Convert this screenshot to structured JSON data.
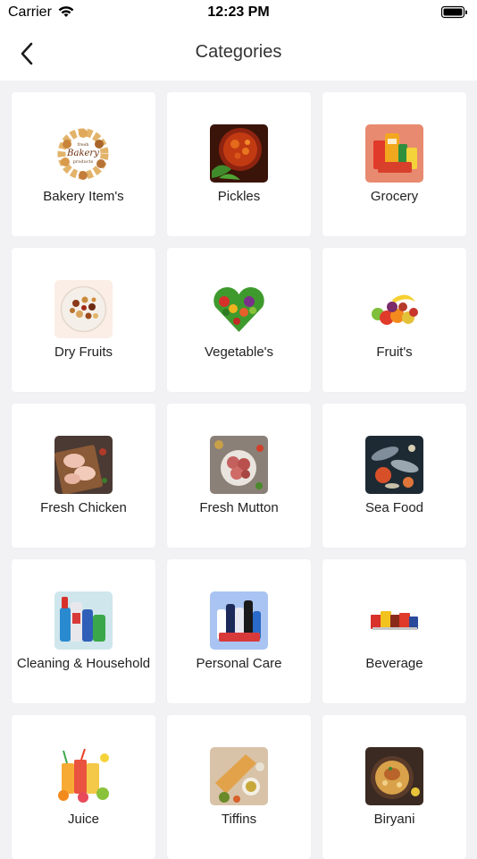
{
  "status": {
    "carrier": "Carrier",
    "time": "12:23 PM"
  },
  "nav": {
    "title": "Categories"
  },
  "categories": [
    {
      "label": "Bakery Item's",
      "icon": "bakery-icon"
    },
    {
      "label": "Pickles",
      "icon": "pickles-icon"
    },
    {
      "label": "Grocery",
      "icon": "grocery-icon"
    },
    {
      "label": "Dry Fruits",
      "icon": "dry-fruits-icon"
    },
    {
      "label": "Vegetable's",
      "icon": "vegetables-icon"
    },
    {
      "label": "Fruit's",
      "icon": "fruits-icon"
    },
    {
      "label": "Fresh Chicken",
      "icon": "chicken-icon"
    },
    {
      "label": "Fresh Mutton",
      "icon": "mutton-icon"
    },
    {
      "label": "Sea Food",
      "icon": "seafood-icon"
    },
    {
      "label": "Cleaning & Household",
      "icon": "cleaning-icon"
    },
    {
      "label": "Personal Care",
      "icon": "personal-care-icon"
    },
    {
      "label": "Beverage",
      "icon": "beverage-icon"
    },
    {
      "label": "Juice",
      "icon": "juice-icon"
    },
    {
      "label": "Tiffins",
      "icon": "tiffins-icon"
    },
    {
      "label": "Biryani",
      "icon": "biryani-icon"
    }
  ],
  "thumb_text": {
    "bakery_word": "Bakery",
    "bakery_top": "fresh",
    "bakery_bottom": "products"
  }
}
